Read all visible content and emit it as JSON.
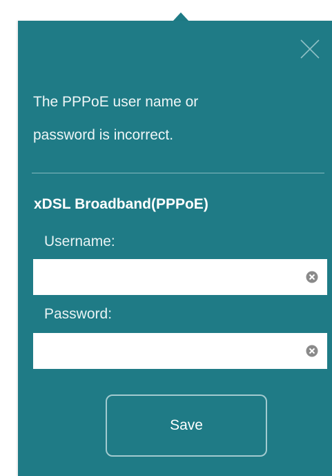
{
  "dialog": {
    "error_line1": "The PPPoE user name or",
    "error_line2": "password is incorrect.",
    "section_title": "xDSL Broadband(PPPoE)",
    "username": {
      "label": "Username:",
      "value": "",
      "placeholder": ""
    },
    "password": {
      "label": "Password:",
      "value": "",
      "placeholder": ""
    },
    "save_label": "Save",
    "icons": {
      "close": "close-icon",
      "clear": "clear-circle-x-icon"
    }
  },
  "colors": {
    "panel_background": "#1f7b86",
    "text": "#ffffff",
    "input_background": "#ffffff",
    "clear_icon": "#8a8a8a"
  }
}
